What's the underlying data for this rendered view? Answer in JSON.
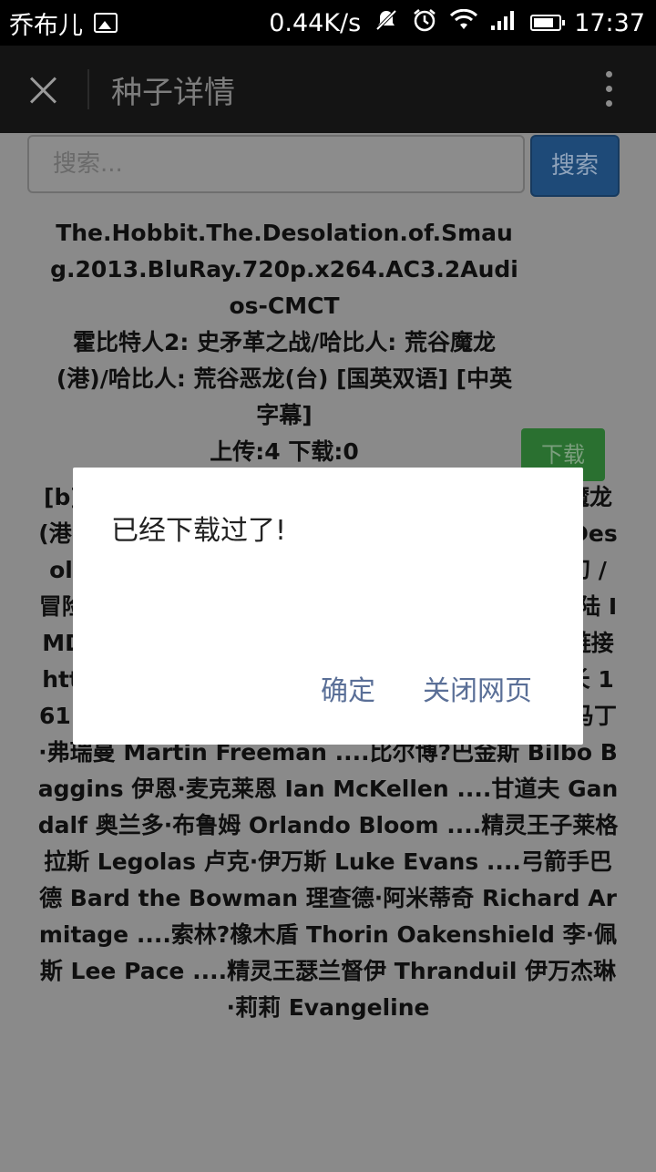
{
  "status_bar": {
    "carrier": "乔布儿",
    "speed": "0.44K/s",
    "time": "17:37",
    "icons": [
      "image-icon",
      "mute-icon",
      "alarm-icon",
      "wifi-icon",
      "signal-icon",
      "battery-icon"
    ]
  },
  "title_bar": {
    "title": "种子详情",
    "close_icon": "close-icon",
    "menu_icon": "more-vert-icon"
  },
  "search": {
    "placeholder": "搜索...",
    "button_label": "搜索"
  },
  "torrent": {
    "title": "The.Hobbit.The.Desolation.of.Smaug.2013.BluRay.720p.x264.AC3.2Audios-CMCT",
    "cn_title": "霍比特人2: 史矛革之战/哈比人: 荒谷魔龙(港)/哈比人: 荒谷恶龙(台) [国英双语] [中英字幕]",
    "stats": "上传:4  下载:0",
    "download_label": "下载",
    "description": "[b]◎译 名 霍比特人2：史矛革之战 / 哈比人：荒谷魔龙(港) / 哈比人：荒谷恶龙(台) / The Hobbit: The Desolation of Smaug 国 家 新西兰 / 美国 类 别 奇幻 / 冒险 语 言 英语 上映日期 2013年12月13日 中国大陆 IMDB评分 8.1/10 from 229,375 users IMDB链接 http://www.imdb.com/title/tt1170358/ 片 长 161 min 导 演 彼得·杰克逊 Peter Jackson 主 演 马丁·弗瑞曼 Martin Freeman ....比尔博?巴金斯 Bilbo Baggins 伊恩·麦克莱恩 Ian McKellen ....甘道夫 Gandalf 奥兰多·布鲁姆 Orlando Bloom ....精灵王子莱格拉斯 Legolas 卢克·伊万斯 Luke Evans ....弓箭手巴德 Bard the Bowman 理查德·阿米蒂奇 Richard Armitage ....索林?橡木盾 Thorin Oakenshield 李·佩斯 Lee Pace ....精灵王瑟兰督伊 Thranduil 伊万杰琳·莉莉 Evangeline"
  },
  "dialog": {
    "message": "已经下载过了!",
    "ok_label": "确定",
    "close_label": "关闭网页"
  }
}
